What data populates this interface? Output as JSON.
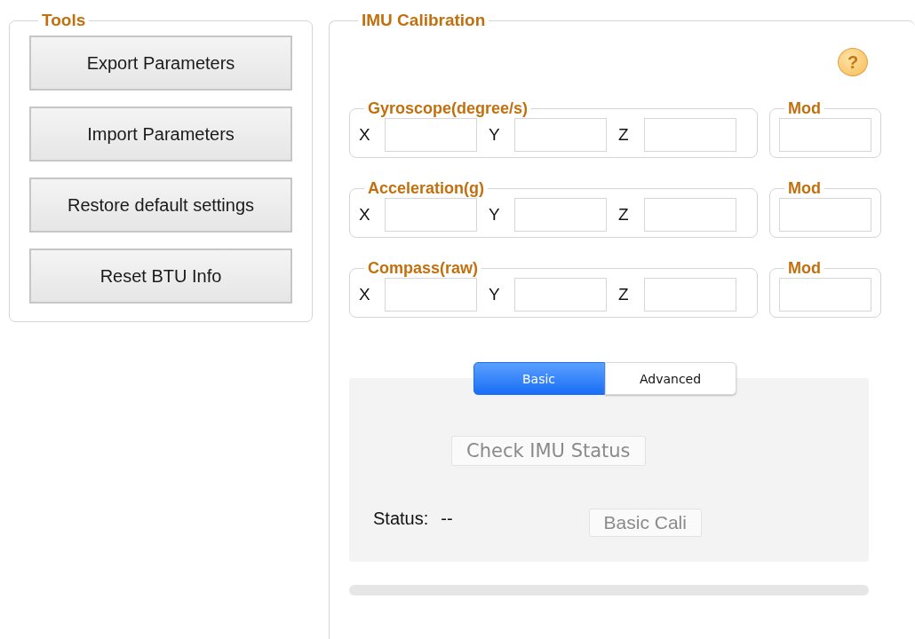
{
  "tools": {
    "title": "Tools",
    "buttons": [
      "Export Parameters",
      "Import Parameters",
      "Restore default settings",
      "Reset BTU Info"
    ]
  },
  "imu": {
    "title": "IMU Calibration",
    "help": "?",
    "sensors": [
      {
        "title": "Gyroscope(degree/s)",
        "axes": [
          "X",
          "Y",
          "Z"
        ],
        "mod_title": "Mod"
      },
      {
        "title": "Acceleration(g)",
        "axes": [
          "X",
          "Y",
          "Z"
        ],
        "mod_title": "Mod"
      },
      {
        "title": "Compass(raw)",
        "axes": [
          "X",
          "Y",
          "Z"
        ],
        "mod_title": "Mod"
      }
    ],
    "tabs": [
      {
        "label": "Basic",
        "selected": true
      },
      {
        "label": "Advanced",
        "selected": false
      }
    ],
    "check_button": {
      "label": "Check IMU Status",
      "disabled": true
    },
    "status": {
      "label": "Status:",
      "value": "--"
    },
    "cali_button": {
      "label": "Basic Cali",
      "disabled": true
    },
    "progress": {
      "level": 0
    }
  }
}
